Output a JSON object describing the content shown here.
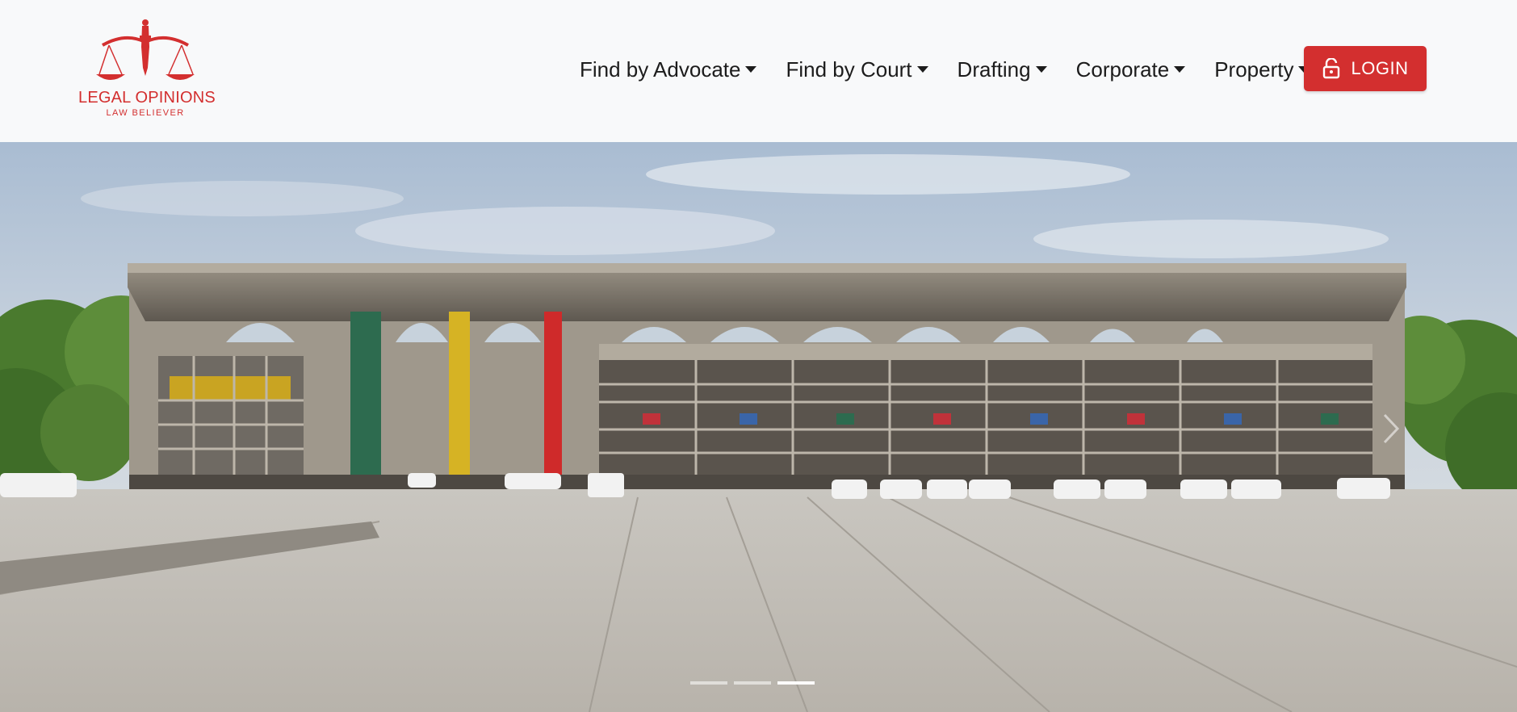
{
  "brand": {
    "name": "LEGAL OPINIONS",
    "tagline": "LAW BELIEVER",
    "logo_icon": "scales-of-justice-pen-icon",
    "color": "#d32f2f"
  },
  "nav": {
    "items": [
      {
        "label": "Find by Advocate",
        "has_dropdown": true
      },
      {
        "label": "Find by Court",
        "has_dropdown": true
      },
      {
        "label": "Drafting",
        "has_dropdown": true
      },
      {
        "label": "Corporate",
        "has_dropdown": true
      },
      {
        "label": "Property",
        "has_dropdown": true
      }
    ],
    "login": {
      "label": "LOGIN",
      "icon": "unlock-icon",
      "color": "#d32f2f"
    }
  },
  "hero": {
    "image": "high-court-building-photo",
    "next_icon": "chevron-right-icon",
    "slides": 3,
    "active_slide": 3
  }
}
